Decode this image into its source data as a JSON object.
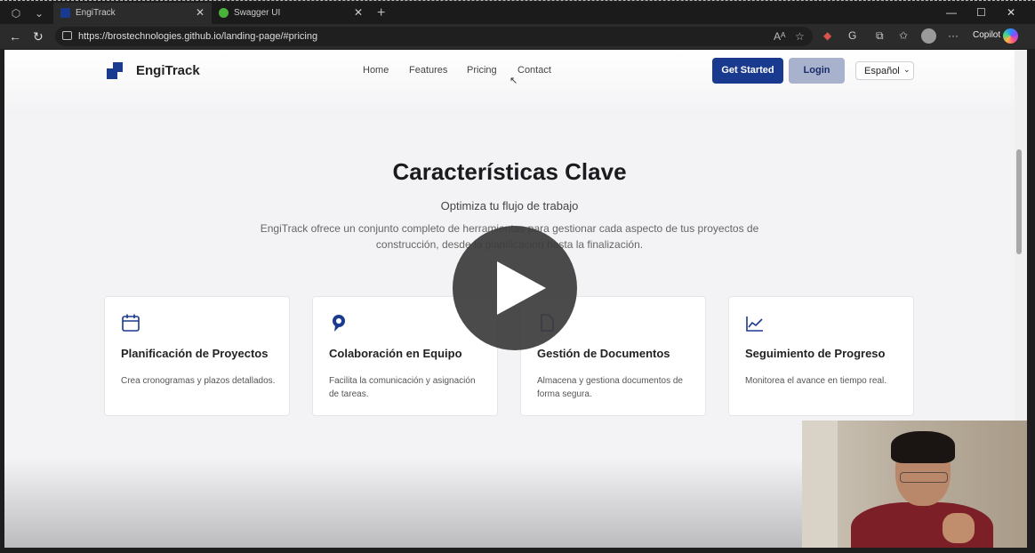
{
  "browser": {
    "tabs": [
      {
        "title": "EngiTrack",
        "active": true
      },
      {
        "title": "Swagger UI",
        "active": false
      }
    ],
    "url": "https://brostechnologies.github.io/landing-page/#pricing",
    "copilot_label": "Copilot",
    "icons": {
      "back": "←",
      "reload": "↻",
      "reader": "Aᴬ",
      "favorite": "☆",
      "more": "···",
      "minimize": "—",
      "maximize": "☐",
      "close": "✕",
      "new_tab": "+"
    }
  },
  "site": {
    "brand": "EngiTrack",
    "nav": [
      "Home",
      "Features",
      "Pricing",
      "Contact"
    ],
    "get_started": "Get Started",
    "login": "Login",
    "language": "Español",
    "accent_color": "#1a3a8f"
  },
  "features": {
    "title": "Características Clave",
    "subtitle": "Optimiza tu flujo de trabajo",
    "description_line1": "EngiTrack ofrece un conjunto completo de herramientas para gestionar cada aspecto de tus proyectos de",
    "description_line2": "construcción, desde la planificación hasta la finalización.",
    "cards": [
      {
        "icon": "calendar-icon",
        "title": "Planificación de Proyectos",
        "desc": "Crea cronogramas y plazos detallados."
      },
      {
        "icon": "collaboration-icon",
        "title": "Colaboración en Equipo",
        "desc": "Facilita la comunicación y asignación de tareas."
      },
      {
        "icon": "document-icon",
        "title": "Gestión de Documentos",
        "desc": "Almacena y gestiona documentos de forma segura."
      },
      {
        "icon": "chart-icon",
        "title": "Seguimiento de Progreso",
        "desc": "Monitorea el avance en tiempo real."
      }
    ]
  }
}
